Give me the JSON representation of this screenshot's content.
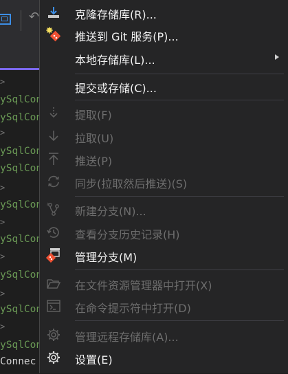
{
  "code": {
    "lines": [
      {
        "text": ">",
        "kind": "chev"
      },
      {
        "text": "ySqlCon",
        "kind": "green"
      },
      {
        "text": "ySqlCon",
        "kind": "green"
      },
      {
        "text": ">",
        "kind": "chev"
      },
      {
        "text": "ySqlCon",
        "kind": "green"
      },
      {
        "text": "ySqlCon",
        "kind": "green"
      },
      {
        "text": ">",
        "kind": "chev"
      },
      {
        "text": "ySqlCon",
        "kind": "green"
      },
      {
        "text": ">",
        "kind": "chev"
      },
      {
        "text": "ySqlCon",
        "kind": "green"
      },
      {
        "text": ">",
        "kind": "chev"
      },
      {
        "text": "ySqlCon",
        "kind": "green"
      },
      {
        "text": ">",
        "kind": "chev"
      },
      {
        "text": "ySqlCon",
        "kind": "green"
      },
      {
        "text": ">",
        "kind": "chev"
      },
      {
        "text": "ySqlCon",
        "kind": "green"
      },
      {
        "text": "Connec",
        "kind": "grey"
      },
      {
        "text": "ySqlCon",
        "kind": "green"
      }
    ]
  },
  "menu": {
    "clone_repo": "克隆存储库(R)...",
    "push_to_git_service": "推送到 Git 服务(P)...",
    "local_repos": "本地存储库(L)...",
    "commit_or_stash": "提交或存储(C)...",
    "fetch": "提取(F)",
    "pull": "拉取(U)",
    "push": "推送(P)",
    "sync": "同步(拉取然后推送)(S)",
    "new_branch": "新建分支(N)...",
    "view_branch_history": "查看分支历史记录(H)",
    "manage_branches": "管理分支(M)",
    "open_in_explorer": "在文件资源管理器中打开(X)",
    "open_in_cmd": "在命令提示符中打开(D)",
    "manage_remotes": "管理远程存储库(A)...",
    "settings": "设置(E)"
  },
  "colors": {
    "menu_bg": "#252526",
    "text_enabled": "#f1f1f1",
    "text_disabled": "#6d6d6d",
    "accent_blue": "#3c8ee6",
    "git_orange": "#f05133"
  }
}
